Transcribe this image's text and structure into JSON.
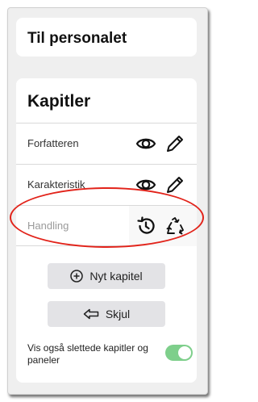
{
  "section_personnel": {
    "title": "Til personalet"
  },
  "chapters": {
    "title": "Kapitler",
    "items": [
      {
        "label": "Forfatteren",
        "state": "active",
        "actions": [
          "eye-icon",
          "pencil-icon"
        ]
      },
      {
        "label": "Karakteristik",
        "state": "active",
        "actions": [
          "eye-icon",
          "pencil-icon"
        ]
      },
      {
        "label": "Handling",
        "state": "deleted",
        "actions": [
          "history-icon",
          "recycle-icon"
        ]
      }
    ]
  },
  "buttons": {
    "add_chapter": "Nyt kapitel",
    "hide": "Skjul"
  },
  "show_deleted": {
    "label": "Vis også slettede kapitler og paneler",
    "enabled": true
  },
  "colors": {
    "toggle_on": "#7ecf8b",
    "highlight": "#e2231a",
    "button_bg": "#e3e3e6"
  }
}
